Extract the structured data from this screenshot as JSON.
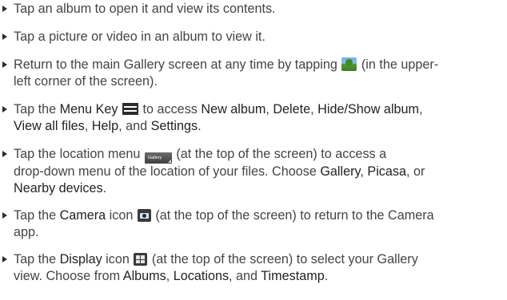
{
  "items": [
    {
      "text": "Tap an album to open it and view its contents."
    },
    {
      "text": "Tap a picture or video in an album to view it."
    },
    {
      "line1_before": "Return to the main Gallery screen at any time by tapping ",
      "icon": "gallery-app-icon",
      "line1_after": " (in the upper-",
      "line2": "left corner of the screen)."
    },
    {
      "before": "Tap the ",
      "kw_menu_key": "Menu Key",
      "icon": "menu-key-icon",
      "mid1": " to access ",
      "kw_new_album": "New album",
      "sep1": ", ",
      "kw_delete": "Delete",
      "sep2": ", ",
      "kw_hide_show": "Hide/Show album",
      "sep3": ",",
      "kw_view_all": "View all files",
      "sep4": ", ",
      "kw_help": "Help",
      "sep5": ", and ",
      "kw_settings": "Settings",
      "end": "."
    },
    {
      "before": "Tap the location menu ",
      "icon": "location-menu-icon",
      "icon_label": "Gallery",
      "after1": " (at the top of the screen) to access a",
      "line2": "drop-down menu of the location of your files. Choose ",
      "kw_gallery": "Gallery",
      "sep1": ", ",
      "kw_picasa": "Picasa",
      "sep2": ", or",
      "kw_nearby": "Nearby devices",
      "end": "."
    },
    {
      "before": "Tap the ",
      "kw_camera": "Camera",
      "mid": " icon ",
      "icon": "camera-icon",
      "after1": " (at the top of the screen) to return to the Camera",
      "line2": "app."
    },
    {
      "before": "Tap the ",
      "kw_display": "Display",
      "mid": " icon ",
      "icon": "display-icon",
      "after1": " (at the top of the screen) to select your Gallery",
      "line2_before": "view. Choose from ",
      "kw_albums": "Albums",
      "sep1": ", ",
      "kw_locations": "Locations",
      "sep2": ", and ",
      "kw_timestamp": "Timestamp",
      "end": "."
    }
  ]
}
